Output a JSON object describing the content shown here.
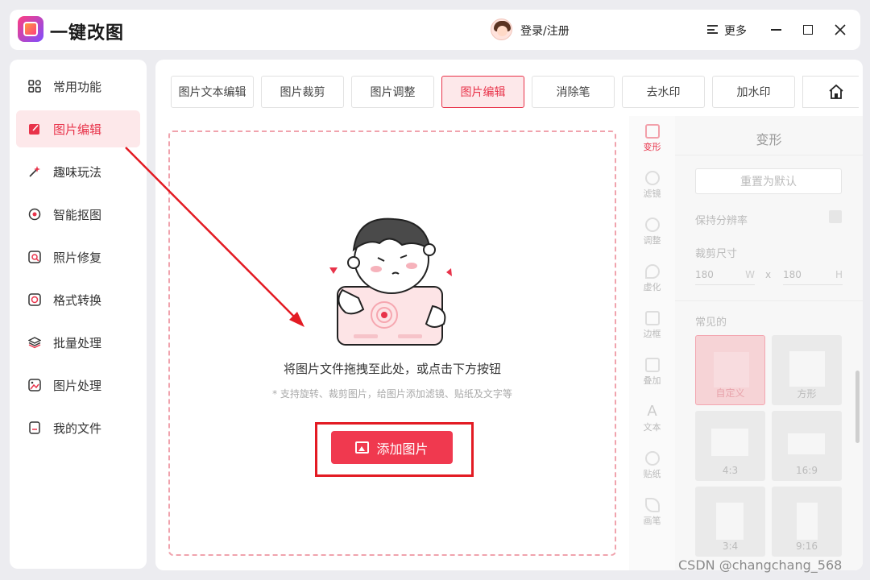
{
  "app": {
    "title": "一键改图"
  },
  "header": {
    "login_label": "登录/注册",
    "more_label": "更多"
  },
  "sidebar": {
    "items": [
      {
        "label": "常用功能",
        "icon": "grid-icon",
        "active": false
      },
      {
        "label": "图片编辑",
        "icon": "edit-icon",
        "active": true
      },
      {
        "label": "趣味玩法",
        "icon": "magic-wand-icon",
        "active": false
      },
      {
        "label": "智能抠图",
        "icon": "target-icon",
        "active": false
      },
      {
        "label": "照片修复",
        "icon": "photo-repair-icon",
        "active": false
      },
      {
        "label": "格式转换",
        "icon": "convert-icon",
        "active": false
      },
      {
        "label": "批量处理",
        "icon": "layers-icon",
        "active": false
      },
      {
        "label": "图片处理",
        "icon": "image-icon",
        "active": false
      },
      {
        "label": "我的文件",
        "icon": "file-icon",
        "active": false
      }
    ]
  },
  "tabs": [
    {
      "label": "图片文本编辑",
      "active": false
    },
    {
      "label": "图片裁剪",
      "active": false
    },
    {
      "label": "图片调整",
      "active": false
    },
    {
      "label": "图片编辑",
      "active": true
    },
    {
      "label": "消除笔",
      "active": false
    },
    {
      "label": "去水印",
      "active": false
    },
    {
      "label": "加水印",
      "active": false
    }
  ],
  "dropzone": {
    "hint": "将图片文件拖拽至此处，或点击下方按钮",
    "sub_hint": "* 支持旋转、裁剪图片，给图片添加滤镜、贴纸及文字等",
    "add_button": "添加图片"
  },
  "tools": [
    {
      "label": "变形",
      "active": true
    },
    {
      "label": "滤镜",
      "active": false
    },
    {
      "label": "调整",
      "active": false
    },
    {
      "label": "虚化",
      "active": false
    },
    {
      "label": "边框",
      "active": false
    },
    {
      "label": "叠加",
      "active": false
    },
    {
      "label": "文本",
      "active": false
    },
    {
      "label": "贴纸",
      "active": false
    },
    {
      "label": "画笔",
      "active": false
    }
  ],
  "panel": {
    "title": "变形",
    "reset_label": "重置为默认",
    "keep_resolution_label": "保持分辨率",
    "crop_size_label": "裁剪尺寸",
    "width_value": "180",
    "width_unit": "W",
    "times": "x",
    "height_value": "180",
    "height_unit": "H",
    "common_label": "常见的",
    "presets": [
      {
        "label": "自定义",
        "active": true
      },
      {
        "label": "方形",
        "active": false
      },
      {
        "label": "4:3",
        "active": false
      },
      {
        "label": "16:9",
        "active": false
      },
      {
        "label": "3:4",
        "active": false
      },
      {
        "label": "9:16",
        "active": false
      }
    ]
  },
  "watermark": "CSDN @changchang_568",
  "colors": {
    "accent": "#e8334a",
    "annotation": "#e31b23"
  }
}
